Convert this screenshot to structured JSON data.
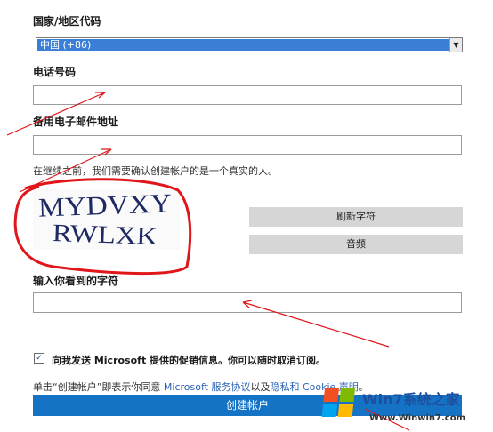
{
  "country": {
    "label": "国家/地区代码",
    "selected": "中国 (+86)"
  },
  "phone": {
    "label": "电话号码",
    "value": ""
  },
  "backup_email": {
    "label": "备用电子邮件地址",
    "value": ""
  },
  "notice": "在继续之前，我们需要确认创建帐户的是一个真实的人。",
  "captcha": {
    "line1": "MYDVXY",
    "line2": "RWLXK"
  },
  "buttons": {
    "refresh": "刷新字符",
    "audio": "音频",
    "create": "创建帐户"
  },
  "captcha_input": {
    "label": "输入你看到的字符",
    "value": ""
  },
  "promo": {
    "checked": true,
    "text": "向我发送 Microsoft 提供的促销信息。你可以随时取消订阅。"
  },
  "terms": {
    "prefix": "单击“创建帐户”即表示你同意 ",
    "link1": "Microsoft 服务协议",
    "mid": "以及",
    "link2": "隐私和 Cookie 声明",
    "suffix": "。"
  },
  "watermark": {
    "brand": "Win7系统之家",
    "url": "Www.Winwin7.com"
  },
  "colors": {
    "primary_button": "#1573c6",
    "link": "#2a62b4",
    "annotation": "#e0161b",
    "secondary_button": "#d6d6d6"
  }
}
